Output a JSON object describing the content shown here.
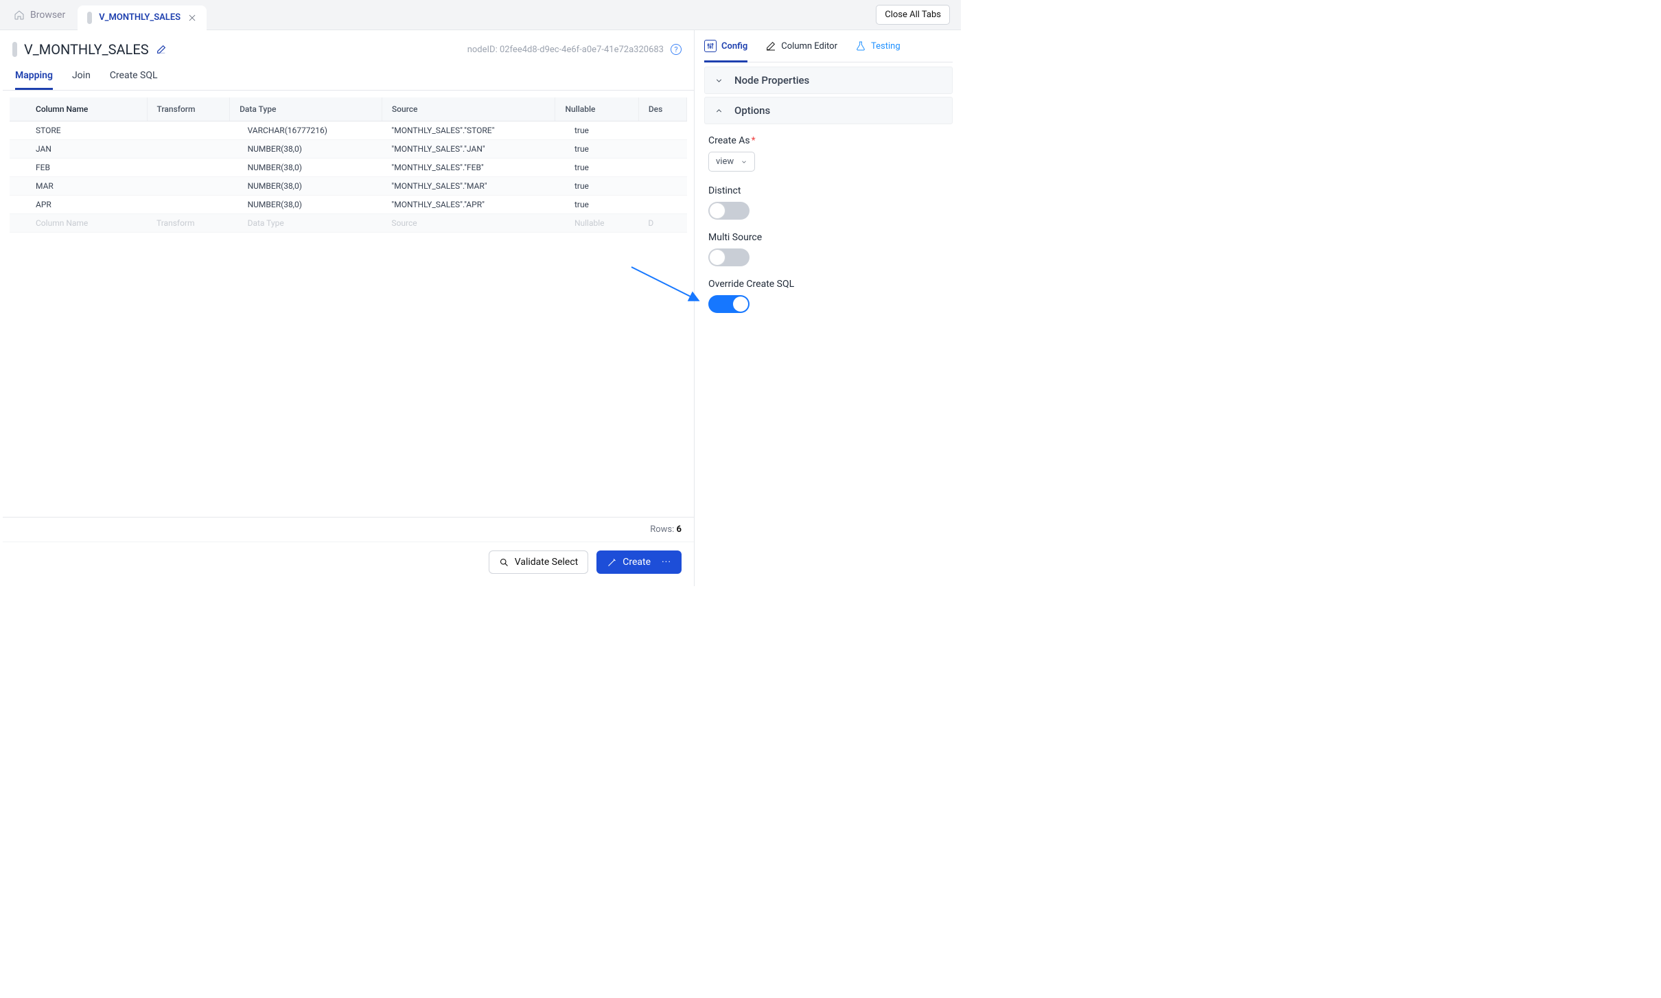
{
  "topbar": {
    "browser_label": "Browser",
    "tab_title": "V_MONTHLY_SALES",
    "close_all_label": "Close All Tabs"
  },
  "header": {
    "title": "V_MONTHLY_SALES",
    "node_id_label": "nodeID: 02fee4d8-d9ec-4e6f-a0e7-41e72a320683"
  },
  "subtabs": {
    "mapping": "Mapping",
    "join": "Join",
    "create_sql": "Create SQL"
  },
  "table": {
    "headers": {
      "col": "Column Name",
      "trans": "Transform",
      "dtype": "Data Type",
      "src": "Source",
      "null": "Nullable",
      "des": "Des"
    },
    "rows": [
      {
        "col": "STORE",
        "trans": "",
        "dtype": "VARCHAR(16777216)",
        "src": "\"MONTHLY_SALES\".\"STORE\"",
        "null": "true"
      },
      {
        "col": "JAN",
        "trans": "",
        "dtype": "NUMBER(38,0)",
        "src": "\"MONTHLY_SALES\".\"JAN\"",
        "null": "true"
      },
      {
        "col": "FEB",
        "trans": "",
        "dtype": "NUMBER(38,0)",
        "src": "\"MONTHLY_SALES\".\"FEB\"",
        "null": "true"
      },
      {
        "col": "MAR",
        "trans": "",
        "dtype": "NUMBER(38,0)",
        "src": "\"MONTHLY_SALES\".\"MAR\"",
        "null": "true"
      },
      {
        "col": "APR",
        "trans": "",
        "dtype": "NUMBER(38,0)",
        "src": "\"MONTHLY_SALES\".\"APR\"",
        "null": "true"
      }
    ],
    "placeholder": {
      "col": "Column Name",
      "trans": "Transform",
      "dtype": "Data Type",
      "src": "Source",
      "null": "Nullable",
      "des": "D"
    },
    "rows_label": "Rows:",
    "rows_count": "6"
  },
  "footer": {
    "validate": "Validate Select",
    "create": "Create",
    "more": "···"
  },
  "side": {
    "tabs": {
      "config": "Config",
      "coleditor": "Column Editor",
      "testing": "Testing"
    },
    "section_props": "Node Properties",
    "section_options": "Options",
    "options": {
      "create_as_label": "Create As",
      "create_as_value": "view",
      "distinct_label": "Distinct",
      "multisource_label": "Multi Source",
      "override_label": "Override Create SQL"
    }
  }
}
